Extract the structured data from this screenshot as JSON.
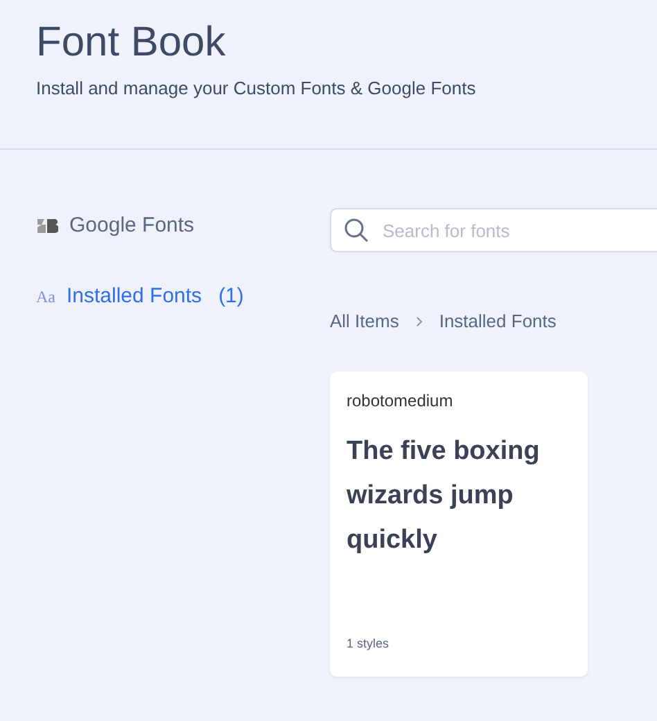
{
  "header": {
    "title": "Font Book",
    "subtitle": "Install and manage your Custom Fonts & Google Fonts"
  },
  "sidebar": {
    "items": [
      {
        "kind": "google",
        "label": "Google Fonts",
        "selected": false
      },
      {
        "kind": "installed",
        "icon": "Aa",
        "label": "Installed Fonts",
        "count": "(1)",
        "selected": true
      }
    ]
  },
  "search": {
    "placeholder": "Search for fonts"
  },
  "breadcrumb": [
    "All Items",
    "Installed Fonts"
  ],
  "cards": [
    {
      "name": "robotomedium",
      "preview": "The five boxing wizards jump quickly",
      "styles": "1 styles"
    }
  ]
}
